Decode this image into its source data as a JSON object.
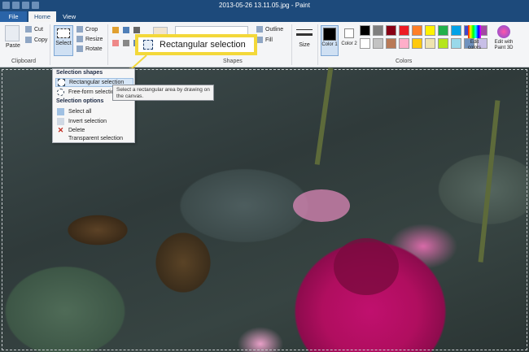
{
  "window": {
    "title": "2013-05-26 13.11.05.jpg - Paint"
  },
  "menu": {
    "file": "File",
    "home": "Home",
    "view": "View"
  },
  "clipboard": {
    "paste": "Paste",
    "cut": "Cut",
    "copy": "Copy",
    "label": "Clipboard"
  },
  "image": {
    "select": "Select",
    "crop": "Crop",
    "resize": "Resize",
    "rotate": "Rotate"
  },
  "shapes": {
    "outline": "Outline",
    "fill": "Fill",
    "label": "Shapes"
  },
  "size": {
    "label": "Size"
  },
  "colors": {
    "color1": "Color 1",
    "color2": "Color 2",
    "edit": "Edit colors",
    "paint3d": "Edit with Paint 3D",
    "label": "Colors"
  },
  "palette": [
    "#000000",
    "#7f7f7f",
    "#880015",
    "#ed1c24",
    "#ff7f27",
    "#fff200",
    "#22b14c",
    "#00a2e8",
    "#3f48cc",
    "#a349a4",
    "#ffffff",
    "#c3c3c3",
    "#b97a57",
    "#ffaec9",
    "#ffc90e",
    "#efe4b0",
    "#b5e61d",
    "#99d9ea",
    "#7092be",
    "#c8bfe7"
  ],
  "callout": {
    "label": "Rectangular selection"
  },
  "dropdown": {
    "shapes_header": "Selection shapes",
    "rect": "Rectangular selection",
    "freeform": "Free-form selection",
    "options_header": "Selection options",
    "select_all": "Select all",
    "invert": "Invert selection",
    "delete": "Delete",
    "transparent": "Transparent selection"
  },
  "tooltip": {
    "text": "Select a rectangular area by drawing on the canvas."
  }
}
